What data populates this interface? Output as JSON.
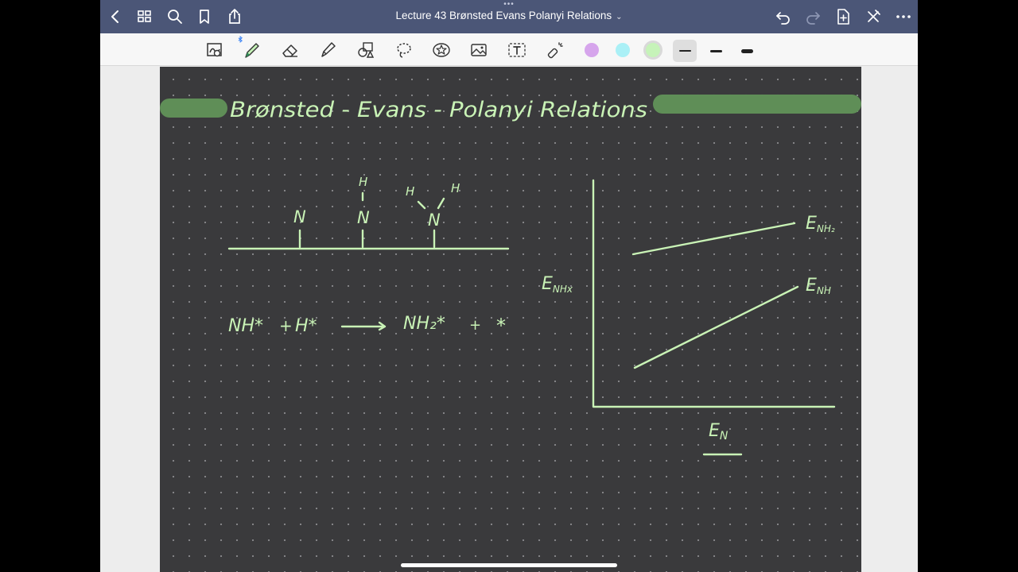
{
  "nav": {
    "title": "Lecture 43 Brønsted Evans Polanyi Relations",
    "title_caret": "⌄",
    "grabber": "•••",
    "icons": [
      "chevron-left-icon",
      "grid-icon",
      "search-icon",
      "bookmark-icon",
      "share-icon",
      "undo-icon",
      "redo-icon",
      "add-page-icon",
      "close-readonly-icon",
      "more-icon"
    ]
  },
  "toolbar": {
    "tools": [
      "lasso-image-icon",
      "pen-icon",
      "eraser-icon",
      "highlighter-icon",
      "shapes-icon",
      "lasso-icon",
      "sticker-icon",
      "image-icon",
      "text-icon",
      "laser-pointer-icon"
    ],
    "swatches": [
      "#d6a5ec",
      "#aaf0f6",
      "#c6f3b9"
    ],
    "selected_swatch": 2,
    "stroke_widths": [
      "thin",
      "medium",
      "thick"
    ],
    "selected_stroke": 0
  },
  "colors": {
    "nav_bg": "#4b5677",
    "page_bg": "#3a3a3c",
    "ink": "#c9f3b6",
    "highlight": "#5f8e57"
  },
  "note": {
    "title": "Brønsted - Evans - Polanyi Relations",
    "adsorbates": {
      "n1": "N",
      "n2_h": "H",
      "n2": "N",
      "n3_h_left": "H",
      "n3_h_right": "H",
      "n3": "N"
    },
    "reaction": {
      "reactant_1": "NH*",
      "plus_1": "+",
      "reactant_2": "H*",
      "arrow": "⟶",
      "product_1": "NH₂*",
      "plus_2": "+",
      "product_2": "*"
    },
    "graph": {
      "y_label": "E",
      "y_sub": "NHx",
      "x_label": "E",
      "x_sub": "N",
      "line_upper_label": "E",
      "line_upper_sub": "NH₂",
      "line_lower_label": "E",
      "line_lower_sub": "NH"
    }
  }
}
